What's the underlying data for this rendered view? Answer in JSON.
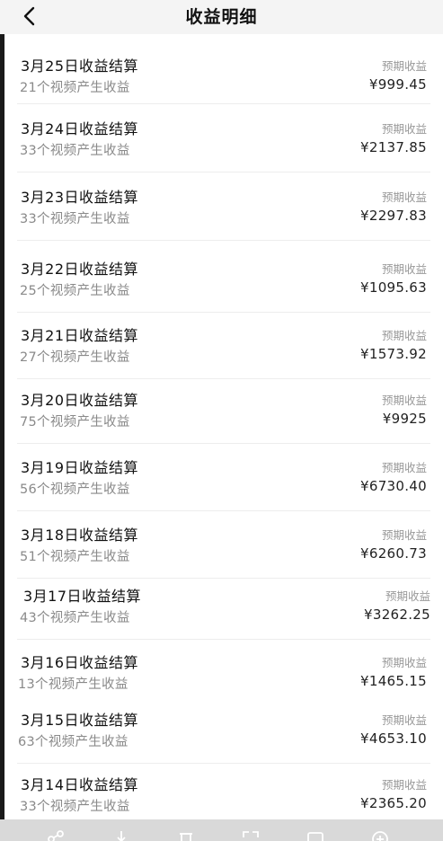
{
  "header": {
    "title": "收益明细",
    "back_icon": "chevron-left-icon"
  },
  "records": [
    {
      "settle": "3月25日收益结算",
      "count": "21个视频产生收益",
      "label": "预期收益",
      "amount": "¥999.45"
    },
    {
      "settle": "3月24日收益结算",
      "count": "33个视频产生收益",
      "label": "预期收益",
      "amount": "¥2137.85"
    },
    {
      "settle": "3月23日收益结算",
      "count": "33个视频产生收益",
      "label": "预期收益",
      "amount": "¥2297.83"
    },
    {
      "settle": "3月22日收益结算",
      "count": "25个视频产生收益",
      "label": "预期收益",
      "amount": "¥1095.63"
    },
    {
      "settle": "3月21日收益结算",
      "count": "27个视频产生收益",
      "label": "预期收益",
      "amount": "¥1573.92"
    },
    {
      "settle": "3月20日收益结算",
      "count": "75个视频产生收益",
      "label": "预期收益",
      "amount": "¥9925"
    },
    {
      "settle": "3月19日收益结算",
      "count": "56个视频产生收益",
      "label": "预期收益",
      "amount": "¥6730.40"
    },
    {
      "settle": "3月18日收益结算",
      "count": "51个视频产生收益",
      "label": "预期收益",
      "amount": "¥6260.73"
    },
    {
      "settle": "3月17日收益结算",
      "count": "43个视频产生收益",
      "label": "预期收益",
      "amount": "¥3262.25"
    },
    {
      "settle": "3月16日收益结算",
      "count": "13个视频产生收益",
      "label": "预期收益",
      "amount": "¥1465.15"
    },
    {
      "settle": "3月15日收益结算",
      "count": "63个视频产生收益",
      "label": "预期收益",
      "amount": "¥4653.10"
    },
    {
      "settle": "3月14日收益结算",
      "count": "33个视频产生收益",
      "label": "预期收益",
      "amount": "¥2365.20"
    }
  ],
  "toolbar": {
    "icons": [
      "share-icon",
      "download-icon",
      "delete-icon",
      "scan-icon",
      "image-icon",
      "add-icon"
    ]
  }
}
